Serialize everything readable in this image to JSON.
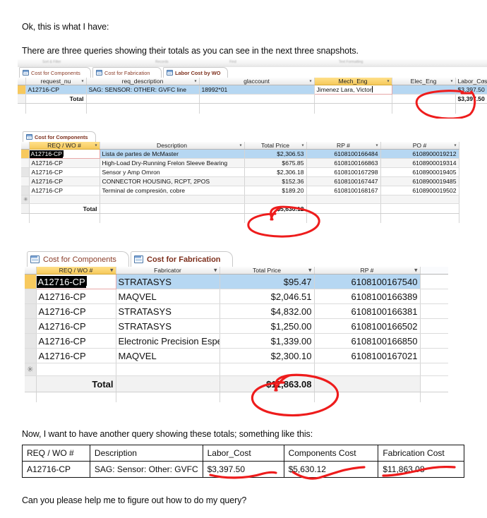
{
  "prose": {
    "intro_1": "Ok, this is what I have:",
    "intro_2": "There are three queries showing their totals as you can see in the next three snapshots.",
    "midtext": "Now, I want to have another query showing these totals; something like this:",
    "outro": "Can you please help me to figure out how to do my query?"
  },
  "colors": {
    "accent_gold": "#f6c95b",
    "row_selected": "#b6d7f2",
    "ink_red": "#ee1c1c",
    "tab_text": "#8a3c28"
  },
  "snapshot_labor": {
    "ribbon_fragments": [
      "Sort & Filter",
      "Records",
      "Find",
      "Text Formatting"
    ],
    "tabs": [
      {
        "label": "Cost for Components",
        "active": false
      },
      {
        "label": "Cost for Fabrication",
        "active": false
      },
      {
        "label": "Labor Cost by WO",
        "active": true
      }
    ],
    "columns": [
      "request_nu",
      "req_description",
      "glaccount",
      "Mech_Eng",
      "Elec_Eng",
      "Labor_Cost"
    ],
    "rows": [
      {
        "request_num": "A12716-CP",
        "req_description": "SAG: SENSOR: OTHER: GVFC line",
        "glaccount": "18992*01",
        "mech_eng": "Jimenez Lara, Victor",
        "elec_eng": "",
        "labor_cost": "$3,397.50"
      }
    ],
    "total_label": "Total",
    "total_value": "$3,397.50"
  },
  "snapshot_components": {
    "tabs": [
      {
        "label": "Cost for Components",
        "active": true
      }
    ],
    "columns": [
      "REQ / WO #",
      "Description",
      "Total Price",
      "RP #",
      "PO #"
    ],
    "rows": [
      {
        "req": "A12716-CP",
        "description": "Lista de partes de McMaster",
        "total_price": "$2,306.53",
        "rp": "6108100166484",
        "po": "6108900019212"
      },
      {
        "req": "A12716-CP",
        "description": "High-Load Dry-Running Frelon Sleeve Bearing",
        "total_price": "$675.85",
        "rp": "6108100166863",
        "po": "6108900019314"
      },
      {
        "req": "A12716-CP",
        "description": "Sensor y Amp Omron",
        "total_price": "$2,306.18",
        "rp": "6108100167298",
        "po": "6108900019405"
      },
      {
        "req": "A12716-CP",
        "description": "CONNECTOR HOUSING, RCPT, 2POS",
        "total_price": "$152.36",
        "rp": "6108100167447",
        "po": "6108900019485"
      },
      {
        "req": "A12716-CP",
        "description": "Terminal de compresión, cobre",
        "total_price": "$189.20",
        "rp": "6108100168167",
        "po": "6108900019502"
      }
    ],
    "total_label": "Total",
    "total_value": "$5,630.12"
  },
  "snapshot_fabrication": {
    "tabs": [
      {
        "label": "Cost for Components",
        "active": false
      },
      {
        "label": "Cost for Fabrication",
        "active": true
      }
    ],
    "columns": [
      "REQ / WO #",
      "Fabricator",
      "Total Price",
      "RP #"
    ],
    "rows": [
      {
        "req": "A12716-CP",
        "fabricator": "STRATASYS",
        "total_price": "$95.47",
        "rp": "6108100167540"
      },
      {
        "req": "A12716-CP",
        "fabricator": "MAQVEL",
        "total_price": "$2,046.51",
        "rp": "6108100166389"
      },
      {
        "req": "A12716-CP",
        "fabricator": "STRATASYS",
        "total_price": "$4,832.00",
        "rp": "6108100166381"
      },
      {
        "req": "A12716-CP",
        "fabricator": "STRATASYS",
        "total_price": "$1,250.00",
        "rp": "6108100166502"
      },
      {
        "req": "A12716-CP",
        "fabricator": "Electronic Precision Espec",
        "total_price": "$1,339.00",
        "rp": "6108100166850"
      },
      {
        "req": "A12716-CP",
        "fabricator": "MAQVEL",
        "total_price": "$2,300.10",
        "rp": "6108100167021"
      }
    ],
    "total_label": "Total",
    "total_value": "$11,863.08"
  },
  "desired_table": {
    "headers": [
      "REQ / WO #",
      "Description",
      "Labor_Cost",
      "Components Cost",
      "Fabrication Cost"
    ],
    "rows": [
      {
        "req": "A12716-CP",
        "description": "SAG: Sensor: Other: GVFC",
        "labor_cost": "$3,397.50",
        "components_cost": "$5,630.12",
        "fabrication_cost": "$11,863.08"
      }
    ]
  },
  "new_record_marker": "✳"
}
